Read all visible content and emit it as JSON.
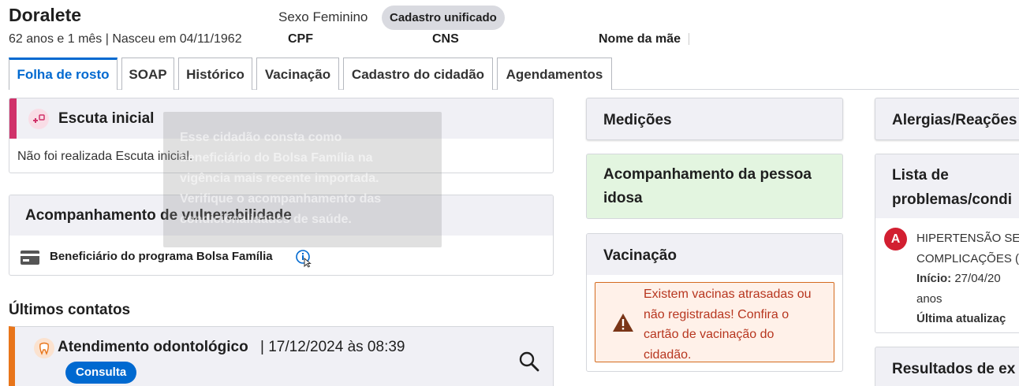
{
  "patient": {
    "name": "Doralete",
    "sex": "Sexo Feminino",
    "badge": "Cadastro unificado",
    "age_info": "62 anos e 1 mês | Nasceu em 04/11/1962",
    "cpf_label": "CPF",
    "cns_label": "CNS",
    "mother_label": "Nome da mãe"
  },
  "tabs": [
    {
      "label": "Folha de rosto",
      "active": true
    },
    {
      "label": "SOAP"
    },
    {
      "label": "Histórico"
    },
    {
      "label": "Vacinação"
    },
    {
      "label": "Cadastro do cidadão"
    },
    {
      "label": "Agendamentos"
    }
  ],
  "escuta": {
    "title": "Escuta inicial",
    "text": "Não foi realizada Escuta inicial."
  },
  "vulnerabilidade": {
    "title": "Acompanhamento de vulnerabilidade",
    "item": "Beneficiário do programa Bolsa Família"
  },
  "tooltip": {
    "text": "Esse cidadão consta como beneficiário do Bolsa Família na vigência mais recente importada. Verifique o acompanhamento das condicionalidades de saúde."
  },
  "ultimos_contatos": {
    "title": "Últimos contatos",
    "item_title": "Atendimento odontológico",
    "item_date": "| 17/12/2024 às 08:39",
    "badge": "Consulta"
  },
  "medicoes": {
    "title": "Medições"
  },
  "idosa": {
    "title": "Acompanhamento da pessoa idosa"
  },
  "vacinacao": {
    "title": "Vacinação",
    "alert": "Existem vacinas atrasadas ou não registradas! Confira o cartão de vacinação do cidadão."
  },
  "alergias": {
    "title": "Alergias/Reações"
  },
  "problemas": {
    "title": "Lista de problemas/condi",
    "item_letter": "A",
    "item_line1": "HIPERTENSÃO SE",
    "item_line2": "COMPLICAÇÕES (",
    "inicio_label": "Início:",
    "inicio_value": "27/04/20",
    "anos": "anos",
    "ultima": "Última atualizaç"
  },
  "resultados": {
    "title": "Resultados de ex"
  },
  "colors": {
    "primary": "#0069d0",
    "escuta_accent": "#d0326a",
    "odonto_accent": "#e8751a",
    "idosa_bg": "#e3f5e0",
    "alert_bg": "#fff1e9",
    "danger": "#d21f31"
  }
}
